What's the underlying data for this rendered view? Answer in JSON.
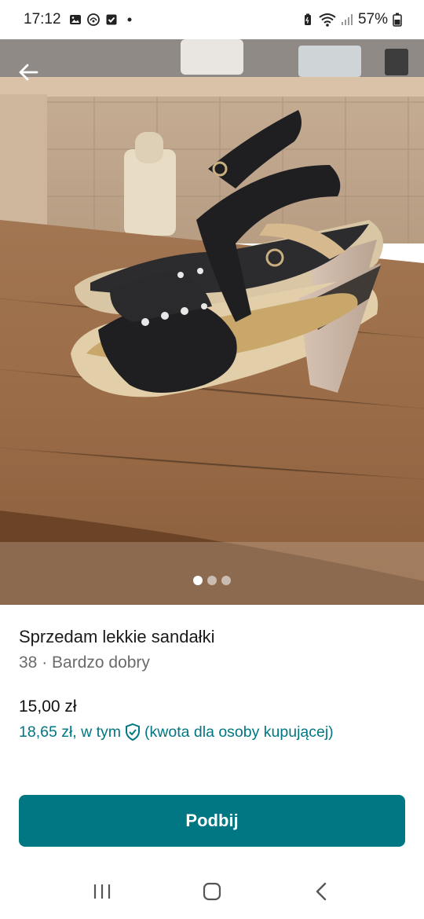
{
  "status_bar": {
    "time": "17:12",
    "battery": "57%"
  },
  "photo": {
    "alt": "sandals photo",
    "pager": {
      "count": 3,
      "active_index": 0
    }
  },
  "listing": {
    "title": "Sprzedam lekkie sandałki",
    "subtitle": "38 · Bardzo dobry",
    "price": "15,00 zł",
    "buyer_price_prefix": "18,65 zł, w tym",
    "buyer_price_suffix": "(kwota dla osoby kupującej)"
  },
  "actions": {
    "bump_label": "Podbij"
  },
  "colors": {
    "accent": "#007782"
  },
  "icons": {
    "back": "arrow-left-icon",
    "shield": "shield-check-icon",
    "nav_recents": "recents-icon",
    "nav_home": "home-icon",
    "nav_back": "chevron-left-icon"
  }
}
